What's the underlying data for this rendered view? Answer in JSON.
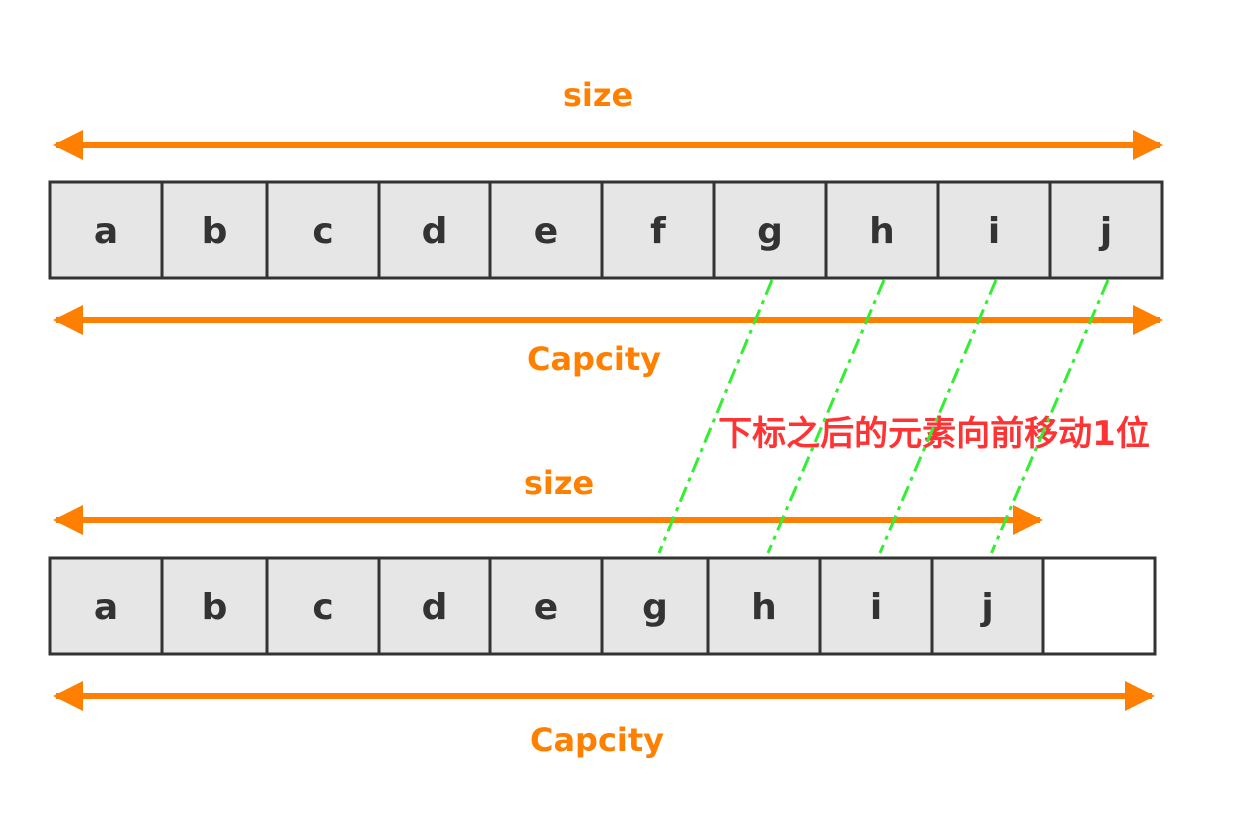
{
  "colors": {
    "accent": "#FF8000",
    "note": "#FF3333",
    "guide": "#33EE33",
    "cell_fill": "#E6E6E6",
    "cell_stroke": "#333333",
    "empty_fill": "#FFFFFF"
  },
  "before": {
    "size_label": "size",
    "capacity_label": "Capcity",
    "cells": [
      "a",
      "b",
      "c",
      "d",
      "e",
      "f",
      "g",
      "h",
      "i",
      "j"
    ]
  },
  "after": {
    "size_label": "size",
    "capacity_label": "Capcity",
    "cells": [
      "a",
      "b",
      "c",
      "d",
      "e",
      "g",
      "h",
      "i",
      "j",
      ""
    ]
  },
  "note": "下标之后的元素向前移动1位",
  "shift_links": [
    {
      "from": "g",
      "to": "g"
    },
    {
      "from": "h",
      "to": "h"
    },
    {
      "from": "i",
      "to": "i"
    },
    {
      "from": "j",
      "to": "j"
    }
  ]
}
